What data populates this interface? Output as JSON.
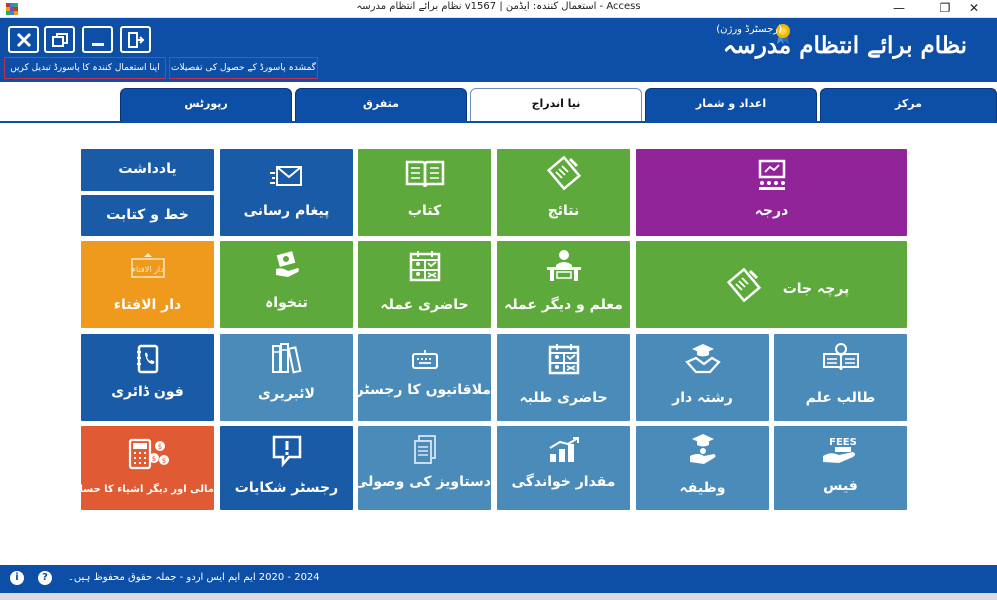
{
  "window": {
    "title": "Access - استعمال کنندہ: ایڈمن   |   v1567   نظام برائے انتظام مدرسہ",
    "minimize_glyph": "—",
    "restore_glyph": "❐",
    "close_glyph": "✕"
  },
  "header": {
    "app_title": "نظام برائے انتظام مدرسہ",
    "registration_label": "(رجسٹرڈ ورژن)",
    "change_password_link": "اپنا استعمال کنندہ کا پاسورڈ تبدیل کریں",
    "forgot_password_link": "گمشدہ پاسورڈ کے حصول کی تفصیلات"
  },
  "tabs": [
    {
      "label": "مرکز",
      "active": false
    },
    {
      "label": "اعداد و شمار",
      "active": false
    },
    {
      "label": "نیا اندراج",
      "active": true
    },
    {
      "label": "متفرق",
      "active": false
    },
    {
      "label": "رپورٹس",
      "active": false
    }
  ],
  "tiles": {
    "yaddasht": "یادداشت",
    "khat_o_kitabat": "خط و کتابت",
    "paigham_rasani": "پیغام رسانی",
    "kitab": "کتاب",
    "nataij": "نتائج",
    "darja": "درجہ",
    "dar_ul_ifta": "دار الافتاء",
    "dar_ul_ifta_icon_text": "دار الافتاء",
    "tankhwah": "تنخواہ",
    "hazri_amla": "حاضری عملہ",
    "muallim_amla": "معلم و دیگر عملہ",
    "parcha_jaat": "پرچہ جات",
    "phone_diary": "فون ڈائری",
    "library": "لائبریری",
    "mulaqat_register": "ملاقاتیوں کا رجسٹر",
    "hazri_talaba": "حاضری طلبہ",
    "rishta_dar": "رشتہ دار",
    "talib_ilm": "طالب علم",
    "maali_hisab": "مالی اور دیگر اشیاء کا حساب",
    "shikayat_register": "رجسٹر شکایات",
    "dastawez_wusooli": "دستاویز کی وصولی",
    "miqdar_khwandagi": "مقدار خواندگی",
    "wazifa": "وظیفہ",
    "fees": "فیس",
    "fees_icon_text": "FEES"
  },
  "footer": {
    "copyright": "2024 - 2020    ایم ایم ایس اردو  -  جملہ حقوق محفوظ ہیں۔",
    "info_glyph": "i",
    "help_glyph": "?"
  },
  "colors": {
    "brand_blue": "#0d4ea6",
    "tile_green": "#5da93b",
    "tile_blue": "#1a5ba7",
    "tile_steel": "#4a8bb9",
    "tile_purple": "#92249a",
    "tile_orange": "#ef9a1c",
    "tile_red": "#e05a34"
  }
}
